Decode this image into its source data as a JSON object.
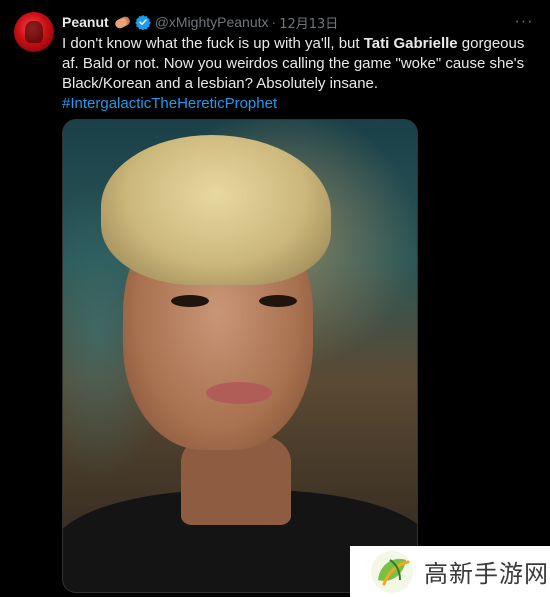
{
  "tweet": {
    "author_name": "Peanut",
    "author_emoji_icon": "peanut-emoji-icon",
    "verified": true,
    "handle": "@xMightyPeanutx",
    "separator": "·",
    "date": "12月13日",
    "more_icon": "more-horizontal-icon",
    "more_label": "···",
    "text": {
      "part1": "I don't know what the fuck is up with ya'll, but ",
      "bold": "Tati Gabrielle",
      "part2": " gorgeous af. Bald or not. Now you weirdos calling the game \"woke\" cause she's Black/Korean and a lesbian? Absolutely insane.",
      "hashtag": "#IntergalacticTheHereticProphet"
    },
    "media_icon": "portrait-photo"
  },
  "watermark": {
    "logo_icon": "leaf-logo-icon",
    "text": "高新手游网"
  },
  "colors": {
    "background": "#000000",
    "text": "#e7e9ea",
    "secondary": "#71767b",
    "link": "#1d9bf0",
    "verified": "#1d9bf0"
  }
}
